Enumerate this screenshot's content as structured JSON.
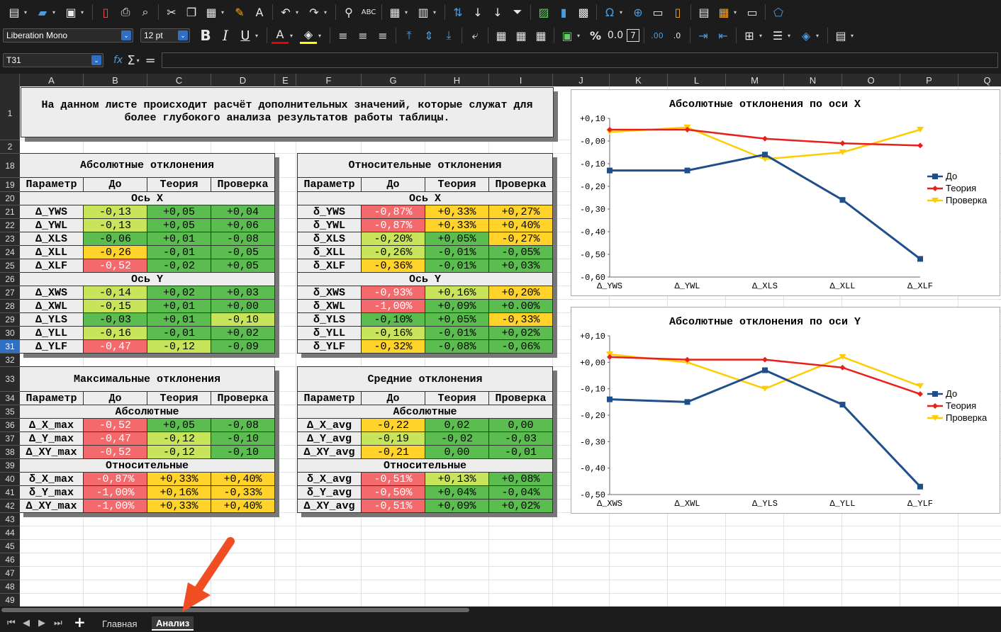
{
  "toolbar": {
    "font_name": "Liberation Mono",
    "font_size": "12 pt",
    "cell_ref": "T31",
    "formula_fx": "fx",
    "formula_sigma": "Σ",
    "formula_eq": "=",
    "formula_value": ""
  },
  "columns": [
    "A",
    "B",
    "C",
    "D",
    "E",
    "F",
    "G",
    "H",
    "I",
    "J",
    "K",
    "L",
    "M",
    "N",
    "O",
    "P",
    "Q"
  ],
  "rows": [
    "1",
    "2",
    "18",
    "19",
    "20",
    "21",
    "22",
    "23",
    "24",
    "25",
    "26",
    "27",
    "28",
    "29",
    "30",
    "31",
    "32",
    "33",
    "34",
    "35",
    "36",
    "37",
    "38",
    "39",
    "40",
    "41",
    "42",
    "43",
    "44",
    "45",
    "46",
    "47",
    "48",
    "49"
  ],
  "selected_row": "31",
  "intro_text_1": "На данном листе происходит расчёт дополнительных значений, которые служат для",
  "intro_text_2": "более глубокого анализа результатов работы таблицы.",
  "headers": [
    "Параметр",
    "До",
    "Теория",
    "Проверка"
  ],
  "abs": {
    "title": "Абсолютные отклонения",
    "sect_x": "Ось X",
    "sect_y": "Ось Y",
    "rows": [
      [
        "Δ_YWS",
        "-0,13",
        "+0,05",
        "+0,04"
      ],
      [
        "Δ_YWL",
        "-0,13",
        "+0,05",
        "+0,06"
      ],
      [
        "Δ_XLS",
        "-0,06",
        "+0,01",
        "-0,08"
      ],
      [
        "Δ_XLL",
        "-0,26",
        "-0,01",
        "-0,05"
      ],
      [
        "Δ_XLF",
        "-0,52",
        "-0,02",
        "+0,05"
      ],
      [
        "Δ_XWS",
        "-0,14",
        "+0,02",
        "+0,03"
      ],
      [
        "Δ_XWL",
        "-0,15",
        "+0,01",
        "+0,00"
      ],
      [
        "Δ_YLS",
        "-0,03",
        "+0,01",
        "-0,10"
      ],
      [
        "Δ_YLL",
        "-0,16",
        "-0,01",
        "+0,02"
      ],
      [
        "Δ_YLF",
        "-0,47",
        "-0,12",
        "-0,09"
      ]
    ]
  },
  "rel": {
    "title": "Относительные отклонения",
    "sect_x": "Ось X",
    "sect_y": "Ось Y",
    "rows": [
      [
        "δ_YWS",
        "-0,87%",
        "+0,33%",
        "+0,27%"
      ],
      [
        "δ_YWL",
        "-0,87%",
        "+0,33%",
        "+0,40%"
      ],
      [
        "δ_XLS",
        "-0,20%",
        "+0,05%",
        "-0,27%"
      ],
      [
        "δ_XLL",
        "-0,26%",
        "-0,01%",
        "-0,05%"
      ],
      [
        "δ_XLF",
        "-0,36%",
        "-0,01%",
        "+0,03%"
      ],
      [
        "δ_XWS",
        "-0,93%",
        "+0,16%",
        "+0,20%"
      ],
      [
        "δ_XWL",
        "-1,00%",
        "+0,09%",
        "+0.00%"
      ],
      [
        "δ_YLS",
        "-0,10%",
        "+0,05%",
        "-0,33%"
      ],
      [
        "δ_YLL",
        "-0,16%",
        "-0,01%",
        "+0,02%"
      ],
      [
        "δ_YLF",
        "-0,32%",
        "-0,08%",
        "-0,06%"
      ]
    ]
  },
  "max": {
    "title": "Максимальные отклонения",
    "sect_a": "Абсолютные",
    "sect_r": "Относительные",
    "rows": [
      [
        "Δ_X_max",
        "-0,52",
        "+0,05",
        "-0,08"
      ],
      [
        "Δ_Y_max",
        "-0,47",
        "-0,12",
        "-0,10"
      ],
      [
        "Δ_XY_max",
        "-0,52",
        "-0,12",
        "-0,10"
      ],
      [
        "δ_X_max",
        "-0,87%",
        "+0,33%",
        "+0,40%"
      ],
      [
        "δ_Y_max",
        "-1,00%",
        "+0,16%",
        "-0,33%"
      ],
      [
        "Δ_XY_max",
        "-1,00%",
        "+0,33%",
        "+0,40%"
      ]
    ]
  },
  "avg": {
    "title": "Средние отклонения",
    "sect_a": "Абсолютные",
    "sect_r": "Относительные",
    "rows": [
      [
        "Δ_X_avg",
        "-0,22",
        "0,02",
        "0,00"
      ],
      [
        "Δ_Y_avg",
        "-0,19",
        "-0,02",
        "-0,03"
      ],
      [
        "Δ_XY_avg",
        "-0,21",
        "0,00",
        "-0,01"
      ],
      [
        "δ_X_avg",
        "-0,51%",
        "+0,13%",
        "+0,08%"
      ],
      [
        "δ_Y_avg",
        "-0,50%",
        "+0,04%",
        "-0,04%"
      ],
      [
        "Δ_XY_avg",
        "-0,51%",
        "+0,09%",
        "+0,02%"
      ]
    ]
  },
  "colors": {
    "red": "#f4696b",
    "yellow": "#ffd32a",
    "lightgreen": "#c8e45a",
    "green": "#5bbd4f",
    "series_do": "#1f4e8c",
    "series_teoria": "#e8201a",
    "series_proverka": "#ffcc00"
  },
  "chart_data": [
    {
      "type": "line",
      "title": "Абсолютные отклонения по оси X",
      "categories": [
        "Δ_YWS",
        "Δ_YWL",
        "Δ_XLS",
        "Δ_XLL",
        "Δ_XLF"
      ],
      "ylim": [
        -0.6,
        0.1
      ],
      "yticks": [
        "+0,10",
        "-0,00",
        "-0,10",
        "-0,20",
        "-0,30",
        "-0,40",
        "-0,50",
        "-0,60"
      ],
      "legend": "right",
      "series": [
        {
          "name": "До",
          "values": [
            -0.13,
            -0.13,
            -0.06,
            -0.26,
            -0.52
          ]
        },
        {
          "name": "Теория",
          "values": [
            0.05,
            0.05,
            0.01,
            -0.01,
            -0.02
          ]
        },
        {
          "name": "Проверка",
          "values": [
            0.04,
            0.06,
            -0.08,
            -0.05,
            0.05
          ]
        }
      ]
    },
    {
      "type": "line",
      "title": "Абсолютные отклонения по оси Y",
      "categories": [
        "Δ_XWS",
        "Δ_XWL",
        "Δ_YLS",
        "Δ_YLL",
        "Δ_YLF"
      ],
      "ylim": [
        -0.5,
        0.1
      ],
      "yticks": [
        "+0,10",
        "+0,00",
        "-0,10",
        "-0,20",
        "-0,30",
        "-0,40",
        "-0,50"
      ],
      "legend": "right",
      "series": [
        {
          "name": "До",
          "values": [
            -0.14,
            -0.15,
            -0.03,
            -0.16,
            -0.47
          ]
        },
        {
          "name": "Теория",
          "values": [
            0.02,
            0.01,
            0.01,
            -0.02,
            -0.12
          ]
        },
        {
          "name": "Проверка",
          "values": [
            0.03,
            0.0,
            -0.1,
            0.02,
            -0.09
          ]
        }
      ]
    }
  ],
  "sheets": [
    "Главная",
    "Анализ"
  ],
  "active_sheet": "Анализ"
}
